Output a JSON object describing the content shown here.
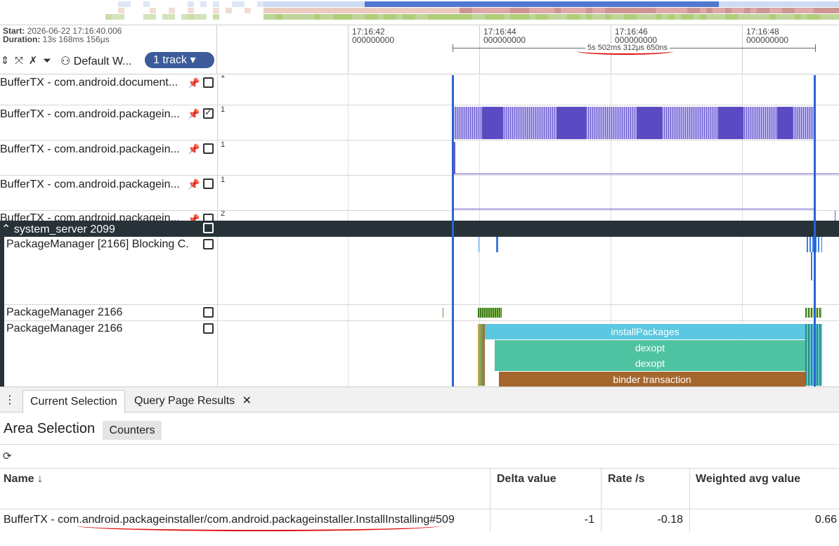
{
  "info": {
    "start_label": "Start:",
    "start_value": "2026-06-22 17:16:40.006",
    "duration_label": "Duration:",
    "duration_value": "13s 168ms 156μs"
  },
  "toolbar": {
    "workspace_label": "Default W...",
    "tracks_chip": "1 track ▾"
  },
  "ruler": {
    "ticks": [
      {
        "time": "17:16:42",
        "ns": "000000000"
      },
      {
        "time": "17:16:44",
        "ns": "000000000"
      },
      {
        "time": "17:16:46",
        "ns": "000000000"
      },
      {
        "time": "17:16:48",
        "ns": "000000000"
      }
    ],
    "selection_duration": "5s 502ms 312μs 650ns"
  },
  "tracks": [
    {
      "title": "BufferTX - com.android.document...",
      "max": "1",
      "checked": false
    },
    {
      "title": "BufferTX - com.android.packagein...",
      "max": "1",
      "checked": true
    },
    {
      "title": "BufferTX - com.android.packagein...",
      "max": "1",
      "checked": false
    },
    {
      "title": "BufferTX - com.android.packagein...",
      "max": "1",
      "checked": false
    },
    {
      "title": "BufferTX - com.android.packagein...",
      "max": "2",
      "checked": false
    }
  ],
  "group": {
    "title": "system_server 2099",
    "children": [
      {
        "title": "PackageManager [2166] Blocking C..."
      },
      {
        "title": "PackageManager 2166"
      },
      {
        "title": "PackageManager 2166"
      }
    ]
  },
  "slices": [
    {
      "name": "installPackages",
      "color": "#5bc7e0"
    },
    {
      "name": "dexopt",
      "color": "#4fc3a1"
    },
    {
      "name": "dexopt",
      "color": "#4fc3a1"
    },
    {
      "name": "binder transaction",
      "color": "#a5662e"
    }
  ],
  "panel": {
    "tabs": [
      "Current Selection",
      "Query Page Results"
    ],
    "close_icon": "✕",
    "title": "Area Selection",
    "counters_button": "Counters",
    "columns": [
      "Name ↓",
      "Delta value",
      "Rate /s",
      "Weighted avg value"
    ],
    "rows": [
      {
        "name": "BufferTX - com.android.packageinstaller/com.android.packageinstaller.InstallInstalling#509",
        "delta": "-1",
        "rate": "-0.18",
        "weighted_avg": "0.66"
      }
    ]
  },
  "colors": {
    "accent": "#2b63d6",
    "chip": "#3b5b9a",
    "group_header": "#263238",
    "counter": "#6a5acd",
    "annotation": "#d11111"
  }
}
